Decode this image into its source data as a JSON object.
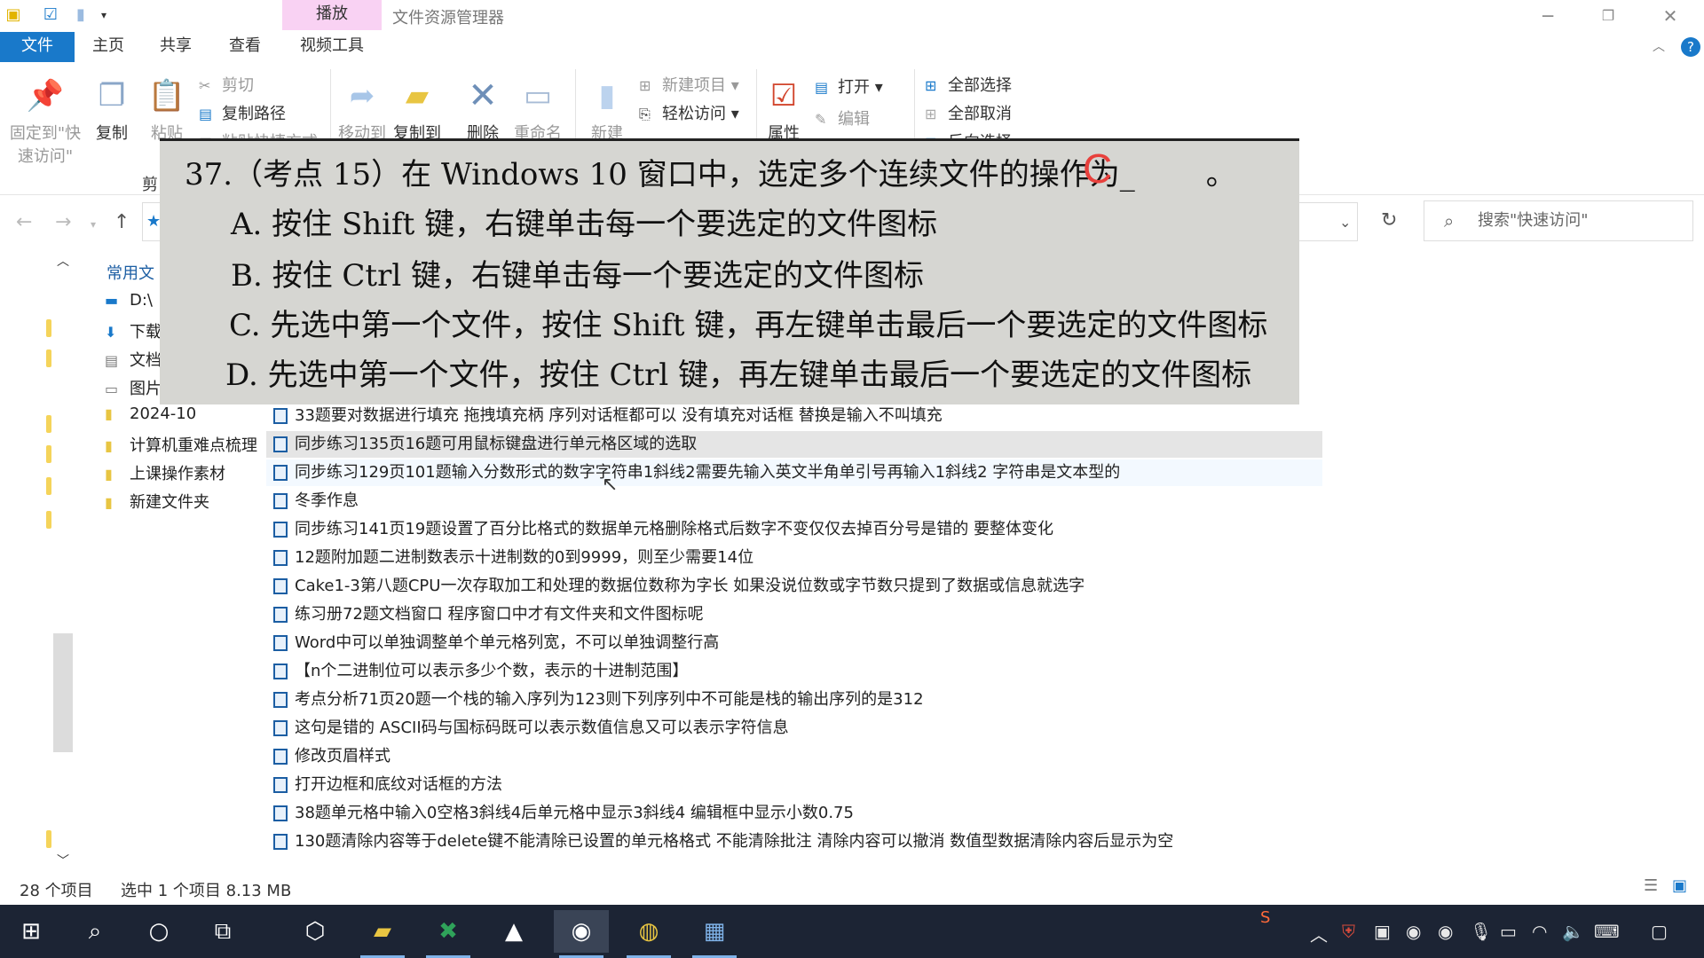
{
  "window": {
    "title": "文件资源管理器",
    "context_tab": "播放",
    "tabs": [
      "文件",
      "主页",
      "共享",
      "查看",
      "视频工具"
    ]
  },
  "ribbon": {
    "pin_line1": "固定到\"快",
    "pin_line2": "速访问\"",
    "copy": "复制",
    "paste": "粘贴",
    "cut": "剪切",
    "copy_path": "复制路径",
    "paste_shortcut": "粘贴快捷方式",
    "clipboard_group": "剪",
    "move_to": "移动到",
    "copy_to": "复制到",
    "delete": "删除",
    "rename": "重命名",
    "new_folder": "新建",
    "new_item": "新建项目",
    "easy_access": "轻松访问",
    "properties": "属性",
    "open": "打开",
    "edit": "编辑",
    "select_all": "全部选择",
    "select_none": "全部取消",
    "invert": "反向选择"
  },
  "search": {
    "placeholder": "搜索\"快速访问\""
  },
  "sidebar": {
    "header": "常用文",
    "items": [
      "D:\\",
      "下载",
      "文档",
      "图片",
      "2024-10",
      "计算机重难点梳理",
      "上课操作素材",
      "新建文件夹"
    ]
  },
  "files": [
    "33题要对数据进行填充 拖拽填充柄 序列对话框都可以 没有填充对话框 替换是输入不叫填充",
    "同步练习135页16题可用鼠标键盘进行单元格区域的选取",
    "同步练习129页101题输入分数形式的数字字符串1斜线2需要先输入英文半角单引号再输入1斜线2 字符串是文本型的",
    "冬季作息",
    "同步练习141页19题设置了百分比格式的数据单元格删除格式后数字不变仅仅去掉百分号是错的 要整体变化",
    "12题附加题二进制数表示十进制数的0到9999，则至少需要14位",
    "Cake1-3第八题CPU一次存取加工和处理的数据位数称为字长  如果没说位数或字节数只提到了数据或信息就选字",
    "练习册72题文档窗口 程序窗口中才有文件夹和文件图标呢",
    "Word中可以单独调整单个单元格列宽，不可以单独调整行高",
    "【n个二进制位可以表示多少个数，表示的十进制范围】",
    "考点分析71页20题一个栈的输入序列为123则下列序列中不可能是栈的输出序列的是312",
    "这句是错的 ASCII码与国标码既可以表示数值信息又可以表示字符信息",
    "修改页眉样式",
    "打开边框和底纹对话框的方法",
    "38题单元格中输入0空格3斜线4后单元格中显示3斜线4 编辑框中显示小数0.75",
    "130题清除内容等于delete键不能清除已设置的单元格格式 不能清除批注 清除内容可以撤消 数值型数据清除内容后显示为空"
  ],
  "status": {
    "count": "28 个项目",
    "selected": "选中 1 个项目  8.13 MB"
  },
  "overlay": {
    "question": "37.（考点 15）在 Windows 10 窗口中，选定多个连续文件的操作为",
    "blank": "_",
    "end": "。",
    "answer": "C",
    "option_a": "A. 按住 Shift 键，右键单击每一个要选定的文件图标",
    "option_b": "B. 按住 Ctrl 键，右键单击每一个要选定的文件图标",
    "option_c": "C. 先选中第一个文件，按住 Shift 键，再左键单击最后一个要选定的文件图标",
    "option_d": "D. 先选中第一个文件，按住 Ctrl 键，再左键单击最后一个要选定的文件图标"
  },
  "colors": {
    "accent": "#1979ca",
    "context_tab": "#f9d2f3",
    "answer": "#e8403c",
    "taskbar": "#1c2434"
  }
}
